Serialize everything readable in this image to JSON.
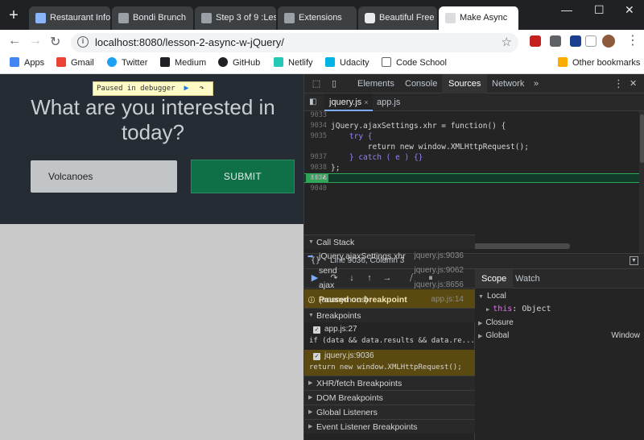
{
  "browser": {
    "tabs": [
      {
        "label": "Restaurant Info",
        "color": "#8ab4f8"
      },
      {
        "label": "Bondi Brunch",
        "color": "#9aa0a6"
      },
      {
        "label": "Step 3 of 9 :Les",
        "color": "#9aa0a6"
      },
      {
        "label": "Extensions",
        "color": "#9aa0a6"
      },
      {
        "label": "Beautiful Free I",
        "color": "#e8eaed"
      },
      {
        "label": "Make Async",
        "color": "#9aa0a6"
      }
    ],
    "url": "localhost:8080/lesson-2-async-w-jQuery/",
    "bookmarks": [
      {
        "label": "Apps",
        "icon": "apps-icon"
      },
      {
        "label": "Gmail",
        "icon": "gmail-icon"
      },
      {
        "label": "Twitter",
        "icon": "twitter-icon"
      },
      {
        "label": "Medium",
        "icon": "medium-icon"
      },
      {
        "label": "GitHub",
        "icon": "github-icon"
      },
      {
        "label": "Netlify",
        "icon": "netlify-icon"
      },
      {
        "label": "Udacity",
        "icon": "udacity-icon"
      },
      {
        "label": "Code School",
        "icon": "page-icon"
      }
    ],
    "other_bookmarks": "Other bookmarks"
  },
  "page": {
    "paused_label": "Paused in debugger",
    "headline": "What are you interested in today?",
    "input_value": "Volcanoes",
    "submit_label": "SUBMIT"
  },
  "devtools": {
    "tabs": [
      "Elements",
      "Console",
      "Sources",
      "Network"
    ],
    "more": "»",
    "files": [
      "jquery.js",
      "app.js"
    ],
    "code_lines": [
      {
        "num": "9033",
        "text": ""
      },
      {
        "num": "9034",
        "text": "jQuery.ajaxSettings.xhr = function() {"
      },
      {
        "num": "9035",
        "text": "    try {"
      },
      {
        "num": "9036",
        "text": "        return new window.XMLHttpRequest();"
      },
      {
        "num": "9037",
        "text": "    } catch ( e ) {}"
      },
      {
        "num": "9038",
        "text": "};"
      },
      {
        "num": "9039",
        "text": ""
      },
      {
        "num": "9040",
        "text": ""
      }
    ],
    "status": "Line 9036, Column 3",
    "paused_on": "Paused on breakpoint",
    "call_stack_title": "Call Stack",
    "call_stack": [
      {
        "fn": "jQuery.ajaxSettings.xhr",
        "loc": "jquery.js:9036"
      },
      {
        "fn": "send",
        "loc": "jquery.js:9062"
      },
      {
        "fn": "ajax",
        "loc": "jquery.js:8656"
      },
      {
        "fn": "(anonymous)",
        "loc": "app.js:14"
      }
    ],
    "breakpoints_title": "Breakpoints",
    "breakpoints": [
      {
        "file": "app.js:27",
        "code": "if (data && data.results && data.re..."
      },
      {
        "file": "jquery.js:9036",
        "code": "return new window.XMLHttpRequest();"
      }
    ],
    "sections": [
      "XHR/fetch Breakpoints",
      "DOM Breakpoints",
      "Global Listeners",
      "Event Listener Breakpoints"
    ],
    "scope_tabs": [
      "Scope",
      "Watch"
    ],
    "scope": {
      "local": "Local",
      "this_key": "this",
      "this_val": "Object",
      "closure": "Closure",
      "global": "Global",
      "global_val": "Window"
    }
  }
}
